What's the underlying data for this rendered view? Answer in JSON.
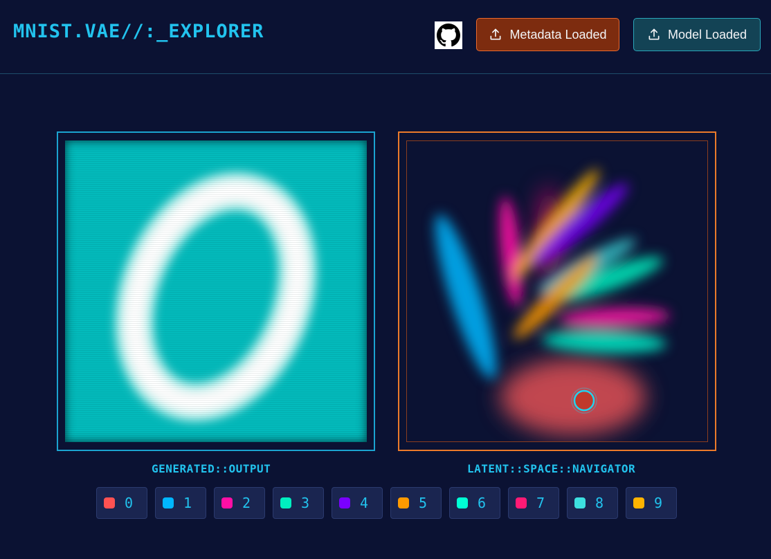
{
  "header": {
    "title": "MNIST.VAE//:_EXPLORER",
    "github_icon": "github-icon",
    "metadata_button": {
      "label": "Metadata Loaded",
      "icon": "upload-icon",
      "color": "#7d2c0f"
    },
    "model_button": {
      "label": "Model Loaded",
      "icon": "upload-icon",
      "color": "#134355"
    }
  },
  "panels": {
    "output_label": "GENERATED::OUTPUT",
    "latent_label": "LATENT::SPACE::NAVIGATOR",
    "output_background": "#03bbbc",
    "selected_cluster_color": "#ff4d4d"
  },
  "legend": [
    {
      "digit": "0",
      "color": "#ff5252"
    },
    {
      "digit": "1",
      "color": "#00b7ff"
    },
    {
      "digit": "2",
      "color": "#ff0fa5"
    },
    {
      "digit": "3",
      "color": "#00f0c0"
    },
    {
      "digit": "4",
      "color": "#7a00ff"
    },
    {
      "digit": "5",
      "color": "#ff9a00"
    },
    {
      "digit": "6",
      "color": "#00ffd5"
    },
    {
      "digit": "7",
      "color": "#ff1a75"
    },
    {
      "digit": "8",
      "color": "#3de0e0"
    },
    {
      "digit": "9",
      "color": "#ffb400"
    }
  ]
}
